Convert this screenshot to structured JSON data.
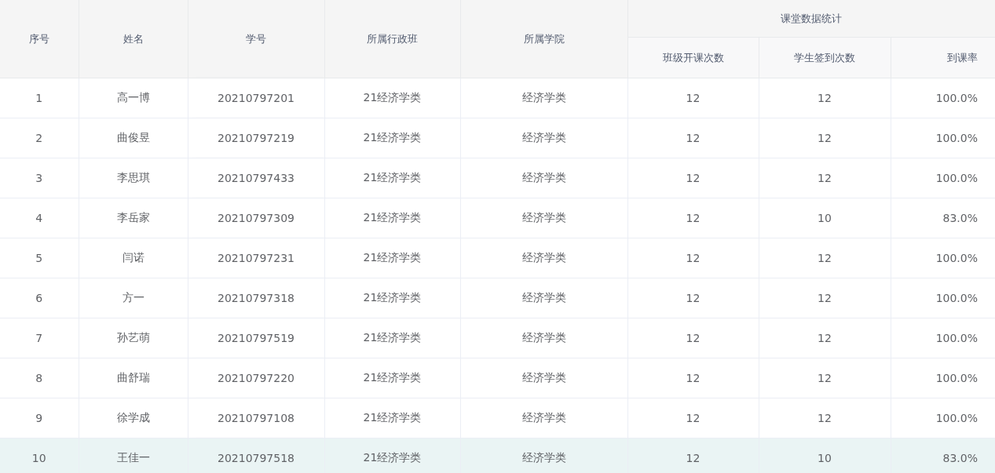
{
  "table": {
    "columns": [
      {
        "label": "序号"
      },
      {
        "label": "姓名"
      },
      {
        "label": "学号"
      },
      {
        "label": "所属行政班"
      },
      {
        "label": "所属学院"
      }
    ],
    "group": {
      "label": "课堂数据统计",
      "columns": [
        {
          "label": "班级开课次数"
        },
        {
          "label": "学生签到次数"
        },
        {
          "label": "到课率"
        }
      ]
    },
    "rows": [
      {
        "cells": [
          "1",
          "高一博",
          "20210797201",
          "21经济学类",
          "经济学类",
          "12",
          "12",
          "100.0%"
        ],
        "highlighted": false
      },
      {
        "cells": [
          "2",
          "曲俊昱",
          "20210797219",
          "21经济学类",
          "经济学类",
          "12",
          "12",
          "100.0%"
        ],
        "highlighted": false
      },
      {
        "cells": [
          "3",
          "李思琪",
          "20210797433",
          "21经济学类",
          "经济学类",
          "12",
          "12",
          "100.0%"
        ],
        "highlighted": false
      },
      {
        "cells": [
          "4",
          "李岳家",
          "20210797309",
          "21经济学类",
          "经济学类",
          "12",
          "10",
          "83.0%"
        ],
        "highlighted": false
      },
      {
        "cells": [
          "5",
          "闫诺",
          "20210797231",
          "21经济学类",
          "经济学类",
          "12",
          "12",
          "100.0%"
        ],
        "highlighted": false
      },
      {
        "cells": [
          "6",
          "方一",
          "20210797318",
          "21经济学类",
          "经济学类",
          "12",
          "12",
          "100.0%"
        ],
        "highlighted": false
      },
      {
        "cells": [
          "7",
          "孙艺萌",
          "20210797519",
          "21经济学类",
          "经济学类",
          "12",
          "12",
          "100.0%"
        ],
        "highlighted": false
      },
      {
        "cells": [
          "8",
          "曲舒瑞",
          "20210797220",
          "21经济学类",
          "经济学类",
          "12",
          "12",
          "100.0%"
        ],
        "highlighted": false
      },
      {
        "cells": [
          "9",
          "徐学成",
          "20210797108",
          "21经济学类",
          "经济学类",
          "12",
          "12",
          "100.0%"
        ],
        "highlighted": false
      },
      {
        "cells": [
          "10",
          "王佳一",
          "20210797518",
          "21经济学类",
          "经济学类",
          "12",
          "10",
          "83.0%"
        ],
        "highlighted": true
      }
    ]
  }
}
